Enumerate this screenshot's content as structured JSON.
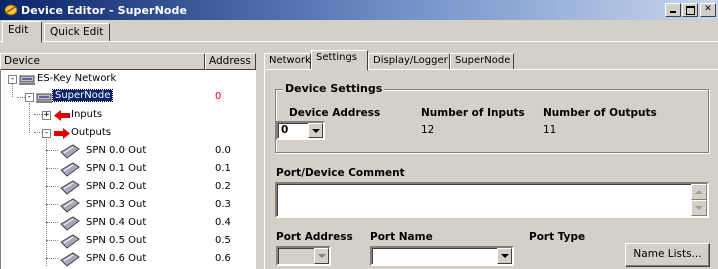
{
  "window": {
    "title": "Device Editor - SuperNode",
    "buttons": [
      "minimize",
      "maximize",
      "close"
    ]
  },
  "top_tabs": [
    {
      "label": "Edit"
    },
    {
      "label": "Quick Edit"
    }
  ],
  "tree": {
    "columns": {
      "device": "Device",
      "address": "Address"
    },
    "rows": [
      {
        "label": "ES-Key Network",
        "address": "",
        "expander": "-",
        "icon": "network-icon"
      },
      {
        "label": "SuperNode",
        "address": "0",
        "expander": "-",
        "icon": "supernode-icon",
        "selected": true
      },
      {
        "label": "Inputs",
        "address": "",
        "expander": "+",
        "icon": "red-arrow-left-icon"
      },
      {
        "label": "Outputs",
        "address": "",
        "expander": "-",
        "icon": "red-arrow-right-icon"
      },
      {
        "label": "SPN 0.0 Out",
        "address": "0.0",
        "icon": "output-port-icon"
      },
      {
        "label": "SPN 0.1 Out",
        "address": "0.1",
        "icon": "output-port-icon"
      },
      {
        "label": "SPN 0.2 Out",
        "address": "0.2",
        "icon": "output-port-icon"
      },
      {
        "label": "SPN 0.3 Out",
        "address": "0.3",
        "icon": "output-port-icon"
      },
      {
        "label": "SPN 0.4 Out",
        "address": "0.4",
        "icon": "output-port-icon"
      },
      {
        "label": "SPN 0.5 Out",
        "address": "0.5",
        "icon": "output-port-icon"
      },
      {
        "label": "SPN 0.6 Out",
        "address": "0.6",
        "icon": "output-port-icon"
      }
    ]
  },
  "right_tabs": [
    {
      "label": "Network"
    },
    {
      "label": "Settings"
    },
    {
      "label": "Display/Logger"
    },
    {
      "label": "SuperNode"
    }
  ],
  "settings": {
    "group_title": "Device Settings",
    "device_address_label": "Device Address",
    "device_address_value": "0",
    "num_inputs_label": "Number of Inputs",
    "num_inputs_value": "12",
    "num_outputs_label": "Number of Outputs",
    "num_outputs_value": "11",
    "comment_label": "Port/Device Comment",
    "port_address_label": "Port Address",
    "port_name_label": "Port Name",
    "port_type_label": "Port Type",
    "name_lists_button": "Name Lists..."
  }
}
